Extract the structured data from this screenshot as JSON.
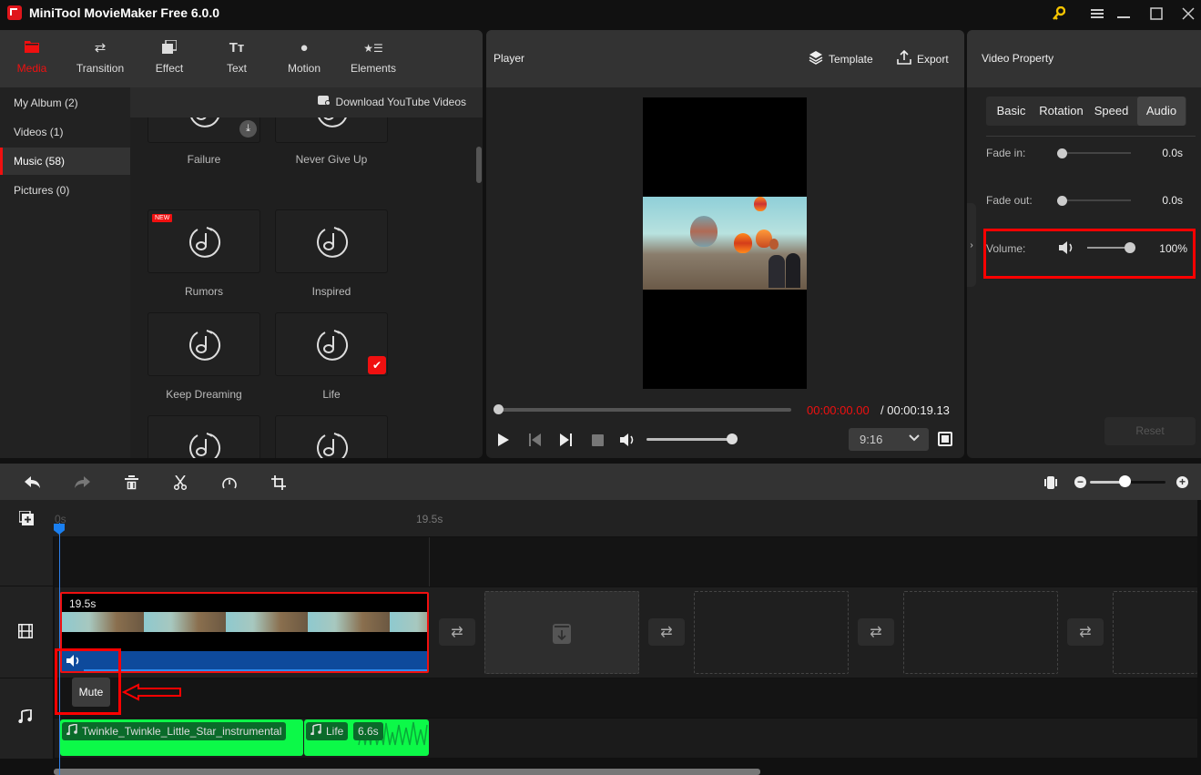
{
  "app": {
    "title": "MiniTool MovieMaker Free 6.0.0",
    "window_controls": [
      "key-icon",
      "menu-icon",
      "minimize-icon",
      "maximize-icon",
      "close-icon"
    ]
  },
  "media_tabs": [
    {
      "label": "Media",
      "icon": "folder-icon",
      "active": true
    },
    {
      "label": "Transition",
      "icon": "swap-icon",
      "active": false
    },
    {
      "label": "Effect",
      "icon": "layers-icon",
      "active": false
    },
    {
      "label": "Text",
      "icon": "text-icon",
      "active": false
    },
    {
      "label": "Motion",
      "icon": "motion-icon",
      "active": false
    },
    {
      "label": "Elements",
      "icon": "elements-icon",
      "active": false
    }
  ],
  "sidebar": {
    "items": [
      {
        "label": "My Album (2)",
        "active": false
      },
      {
        "label": "Videos (1)",
        "active": false
      },
      {
        "label": "Music (58)",
        "active": true
      },
      {
        "label": "Pictures (0)",
        "active": false
      }
    ]
  },
  "media_content": {
    "download_link": "Download YouTube Videos",
    "music_items": [
      {
        "title": "Failure",
        "badge": "download"
      },
      {
        "title": "Never Give Up",
        "badge": ""
      },
      {
        "title": "Rumors",
        "badge": "NEW"
      },
      {
        "title": "Inspired",
        "badge": ""
      },
      {
        "title": "Keep Dreaming",
        "badge": ""
      },
      {
        "title": "Life",
        "badge": "added"
      },
      {
        "title": "",
        "badge": ""
      },
      {
        "title": "",
        "badge": ""
      }
    ]
  },
  "player": {
    "title": "Player",
    "template_label": "Template",
    "export_label": "Export",
    "current_time": "00:00:00.00",
    "separator": " / ",
    "total_time": "00:00:19.13",
    "progress": 0,
    "volume": 1.0,
    "aspect_ratio": "9:16"
  },
  "property": {
    "title": "Video Property",
    "tabs": [
      {
        "label": "Basic",
        "active": false
      },
      {
        "label": "Rotation",
        "active": false
      },
      {
        "label": "Speed",
        "active": false
      },
      {
        "label": "Audio",
        "active": true
      }
    ],
    "fade_in": {
      "label": "Fade in:",
      "value": "0.0s",
      "fraction": 0
    },
    "fade_out": {
      "label": "Fade out:",
      "value": "0.0s",
      "fraction": 0
    },
    "volume": {
      "label": "Volume:",
      "value": "100%",
      "fraction": 1.0
    },
    "reset_label": "Reset"
  },
  "timeline": {
    "toolbar": [
      "undo-icon",
      "redo-icon",
      "delete-icon",
      "split-icon",
      "speed-icon",
      "crop-icon"
    ],
    "zoom_fraction": 0.45,
    "ruler": {
      "start": "0s",
      "end": "19.5s"
    },
    "video_clip": {
      "duration": "19.5s"
    },
    "mute_label": "Mute",
    "audio_clips": [
      {
        "title": "Twinkle_Twinkle_Little_Star_instrumental",
        "duration": ""
      },
      {
        "title": "Life",
        "duration": "6.6s"
      }
    ]
  },
  "colors": {
    "accent": "#f01010",
    "playhead": "#1a7ff0",
    "audio_clip": "#0cf948",
    "video_audio_bar": "#0e4a9c"
  }
}
